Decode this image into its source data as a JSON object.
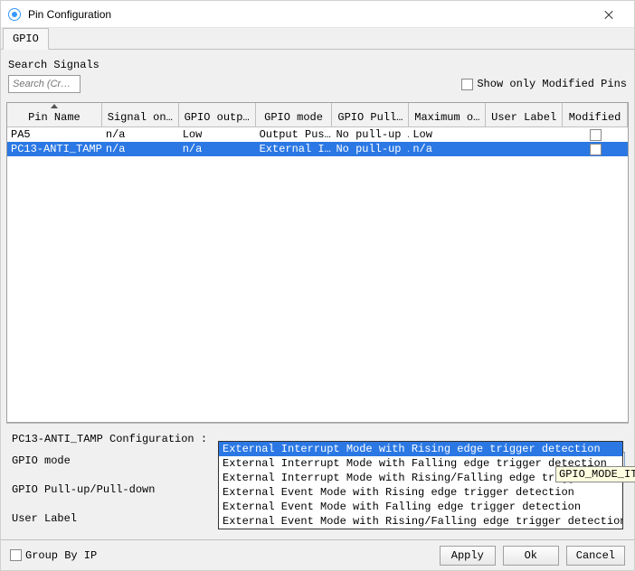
{
  "window": {
    "title": "Pin Configuration"
  },
  "tabs": {
    "gpio": "GPIO"
  },
  "search": {
    "label": "Search Signals",
    "placeholder": "Search (Cr…"
  },
  "showOnlyModified": {
    "label": "Show only Modified Pins",
    "checked": false
  },
  "table": {
    "columns": [
      "Pin Name",
      "Signal on…",
      "GPIO outp…",
      "GPIO mode",
      "GPIO Pull…",
      "Maximum o…",
      "User Label",
      "Modified"
    ],
    "rows": [
      {
        "pin": "PA5",
        "signal": "n/a",
        "outp": "Low",
        "mode": "Output Pus…",
        "pull": "No pull-up …",
        "max": "Low",
        "user": "",
        "modified": false,
        "selected": false
      },
      {
        "pin": "PC13-ANTI_TAMP",
        "signal": "n/a",
        "outp": "n/a",
        "mode": "External I…",
        "pull": "No pull-up …",
        "max": "n/a",
        "user": "",
        "modified": false,
        "selected": true
      }
    ]
  },
  "configPanel": {
    "title": "PC13-ANTI_TAMP Configuration :",
    "rows": {
      "mode": {
        "label": "GPIO mode",
        "value": "External Interrupt Mode with Rising edge trigger detection"
      },
      "pull": {
        "label": "GPIO Pull-up/Pull-down",
        "value": ""
      },
      "userLabel": {
        "label": "User Label",
        "value": ""
      }
    }
  },
  "dropdownOptions": [
    "External Interrupt Mode with Rising edge trigger detection",
    "External Interrupt Mode with Falling edge trigger detection",
    "External Interrupt Mode with Rising/Falling edge trigger detecti",
    "External Event Mode with Rising edge trigger detection",
    "External Event Mode with Falling edge trigger detection",
    "External Event Mode with Rising/Falling edge trigger detection"
  ],
  "tooltip": "GPIO_MODE_IT_F",
  "footer": {
    "groupByIp": {
      "label": "Group By IP",
      "checked": false
    },
    "apply": "Apply",
    "ok": "Ok",
    "cancel": "Cancel"
  }
}
